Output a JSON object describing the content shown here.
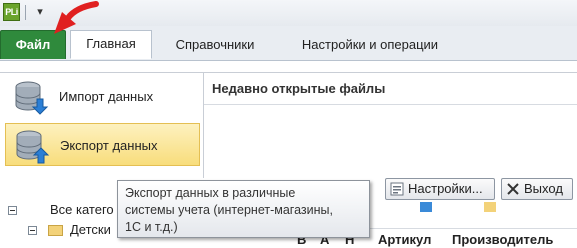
{
  "titlebar": {
    "app_icon_text": "PLi",
    "quick_access_glyph": "▾"
  },
  "ribbon": {
    "file_tab": "Файл",
    "tabs": [
      {
        "label": "Главная"
      },
      {
        "label": "Справочники"
      },
      {
        "label": "Настройки и операции"
      }
    ],
    "active_tab_color": "#2f8a3c"
  },
  "backstage": {
    "items": [
      {
        "label": "Импорт данных",
        "icon": "database-import-icon"
      },
      {
        "label": "Экспорт данных",
        "icon": "database-export-icon",
        "selected": true
      }
    ],
    "recent_title": "Недавно открытые файлы"
  },
  "buttons": {
    "settings": "Настройки...",
    "exit": "Выход"
  },
  "tooltip": {
    "line1": "Экспорт данных в различные",
    "line2": "системы учета (интернет-магазины,",
    "line3": "1С и т.д.)"
  },
  "tree": {
    "root": "Все катего",
    "child": "Детски"
  },
  "grid": {
    "columns": [
      "В",
      "А",
      "Н",
      "Артикул",
      "Производитель"
    ]
  },
  "colors": {
    "file_tab": "#2f8a3c",
    "selection": "#f8dd7c",
    "annotation_arrow": "#e02020"
  }
}
